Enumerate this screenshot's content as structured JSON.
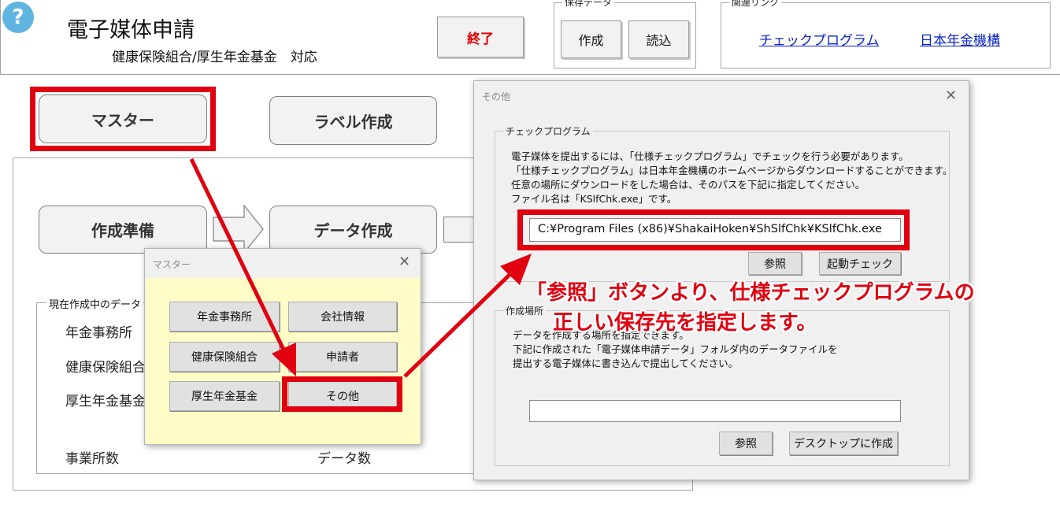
{
  "header": {
    "help_glyph": "?",
    "title": "電子媒体申請",
    "subtitle": "健康保険組合/厚生年金基金　対応",
    "exit_label": "終了",
    "save_group": {
      "legend": "保存データ",
      "create_label": "作成",
      "load_label": "読込"
    },
    "links_group": {
      "legend": "関連リンク",
      "check_program_link": "チェックプログラム",
      "pension_link": "日本年金機構"
    }
  },
  "main": {
    "master_button": "マスター",
    "label_button": "ラベル作成",
    "prepare_button": "作成準備",
    "data_button": "データ作成",
    "current_panel": {
      "legend": "現在作成中のデータ",
      "row1": "年金事務所",
      "row2": "健康保険組合",
      "row3": "厚生年金基金",
      "count_office": "事業所数",
      "count_data": "データ数"
    }
  },
  "master_dialog": {
    "title": "マスター",
    "close": "✕",
    "buttons": [
      "年金事務所",
      "会社情報",
      "健康保険組合",
      "申請者",
      "厚生年金基金",
      "その他"
    ]
  },
  "other_dialog": {
    "title": "その他",
    "close": "✕",
    "check_group": {
      "legend": "チェックプログラム",
      "lines": [
        "電子媒体を提出するには、「仕様チェックプログラム」でチェックを行う必要があります。",
        "「仕様チェックプログラム」は日本年金機構のホームページからダウンロードすることができます。",
        "任意の場所にダウンロードをした場合は、そのパスを下記に指定してください。",
        "ファイル名は「KSlfChk.exe」です。"
      ],
      "path_value": "C:¥Program Files (x86)¥ShakaiHoken¥ShSlfChk¥KSlfChk.exe",
      "browse_label": "参照",
      "start_check_label": "起動チェック"
    },
    "location_group": {
      "legend": "作成場所",
      "lines": [
        "データを作成する場所を指定できます。",
        "下記に作成された「電子媒体申請データ」フォルダ内のデータファイルを",
        "提出する電子媒体に書き込んで提出してください。"
      ],
      "path_value": "",
      "browse_label": "参照",
      "desktop_label": "デスクトップに作成"
    }
  },
  "annotation": {
    "line1": "「参照」ボタンより、仕様チェックプログラムの",
    "line2": "正しい保存先を指定します。"
  },
  "colors": {
    "highlight_red": "#e00010",
    "link_blue": "#0b24c7",
    "master_dialog_body": "#fffcc8",
    "help_icon": "#5fb4e0"
  }
}
